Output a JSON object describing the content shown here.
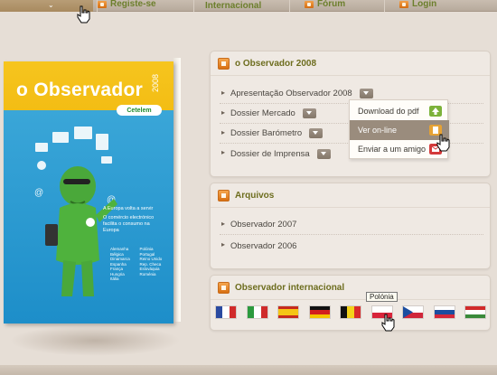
{
  "nav": {
    "items": [
      {
        "label": ""
      },
      {
        "label": "Registe-se"
      },
      {
        "label": "Internacional"
      },
      {
        "label": "Fórum"
      },
      {
        "label": "Login"
      }
    ]
  },
  "magazine": {
    "title": "o Observador",
    "year": "2008",
    "brand": "Cetelem",
    "headline": "A Europa volta a servir",
    "subhead": "O comércio electrónico facilita o consumo na Europa",
    "countries": [
      "Alemanha",
      "Bélgica",
      "Dinamarca",
      "Espanha",
      "França",
      "Hungria",
      "Itália",
      "Polónia",
      "Portugal",
      "Reino Unido",
      "Rep. Checa",
      "Eslováquia",
      "Roménia"
    ]
  },
  "panel_2008": {
    "title": "o Observador 2008",
    "items": [
      {
        "label": "Apresentação Observador 2008"
      },
      {
        "label": "Dossier Mercado"
      },
      {
        "label": "Dossier Barómetro"
      },
      {
        "label": "Dossier de Imprensa"
      }
    ],
    "dropdown": [
      {
        "label": "Download do pdf"
      },
      {
        "label": "Ver on-line"
      },
      {
        "label": "Enviar a um amigo"
      }
    ]
  },
  "panel_arquivos": {
    "title": "Arquivos",
    "items": [
      {
        "label": "Observador 2007"
      },
      {
        "label": "Observador 2006"
      }
    ]
  },
  "panel_internacional": {
    "title": "Observador internacional",
    "tooltip": "Polónia"
  },
  "colors": {
    "accent": "#6c7f2c",
    "panel_bg": "#efe9e3",
    "orange": "#e07a1a"
  }
}
